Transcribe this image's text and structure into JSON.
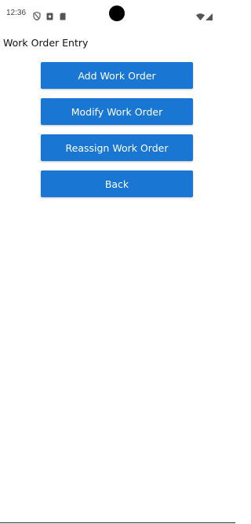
{
  "status_bar": {
    "time": "12:36",
    "icons": [
      "shield-icon",
      "sim-card-icon",
      "sd-card-icon",
      "camera-cutout",
      "wifi-icon",
      "cell-signal-icon"
    ]
  },
  "page": {
    "title": "Work Order Entry"
  },
  "buttons": {
    "add_label": "Add Work Order",
    "modify_label": "Modify Work Order",
    "reassign_label": "Reassign Work Order",
    "back_label": "Back"
  },
  "colors": {
    "button_background": "#1976d2",
    "button_text": "#ffffff",
    "background": "#ffffff"
  }
}
